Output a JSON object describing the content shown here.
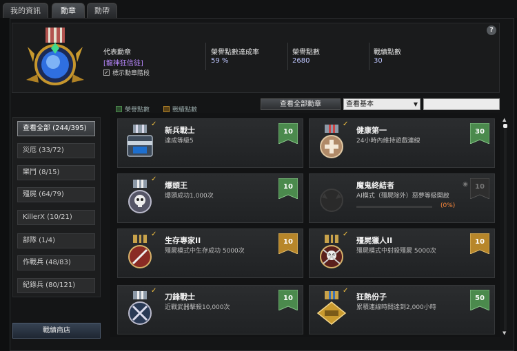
{
  "tabs": [
    {
      "label": "我的資訊",
      "active": false
    },
    {
      "label": "勳章",
      "active": true
    },
    {
      "label": "勳帶",
      "active": false
    }
  ],
  "header": {
    "help_label": "?",
    "rep_medal_label": "代表勳章",
    "rep_medal_name": "[龍神狂信徒]",
    "show_level_label": "標示勳章階段",
    "show_level_checked": "✓",
    "stats": [
      {
        "label": "榮譽點數達成率",
        "value": "59 %"
      },
      {
        "label": "榮譽點數",
        "value": "2680"
      },
      {
        "label": "戰績點數",
        "value": "30"
      }
    ]
  },
  "legend": {
    "honor": "榮譽點數",
    "battle": "戰績點數"
  },
  "filter": {
    "view_all_button": "查看全部勳章",
    "dropdown_value": "查看基本",
    "dropdown_arrow": "▼",
    "search_placeholder": ""
  },
  "categories": [
    {
      "label": "查看全部 (244/395)",
      "active": true
    },
    {
      "label": "災厄 (33/72)",
      "active": false
    },
    {
      "label": "樂鬥 (8/15)",
      "active": false
    },
    {
      "label": "殭屍 (64/79)",
      "active": false
    },
    {
      "label": "KillerX (10/21)",
      "active": false
    },
    {
      "label": "部隊 (1/4)",
      "active": false
    },
    {
      "label": "作戰兵 (48/83)",
      "active": false
    },
    {
      "label": "紀錄兵 (80/121)",
      "active": false
    }
  ],
  "shop_button": "戰績商店",
  "medals": [
    {
      "title": "新兵戰士",
      "desc": "達成等級5",
      "points": "10",
      "type": "honor",
      "achieved": true,
      "icon": "welcome-cso-medal-icon"
    },
    {
      "title": "健康第一",
      "desc": "24小時內維持遊戲連線",
      "points": "30",
      "type": "honor",
      "achieved": true,
      "icon": "health-medal-icon"
    },
    {
      "title": "爆頭王",
      "desc": "爆頭成功1,000次",
      "points": "10",
      "type": "honor",
      "achieved": true,
      "icon": "skull-medal-icon"
    },
    {
      "title": "魔鬼終結者",
      "desc": "AI模式（殭屍除外）惡夢等級開啟",
      "points": "10",
      "type": "locked",
      "achieved": false,
      "icon": "demon-medal-icon",
      "progress_text": "(0%)",
      "progress": 0
    },
    {
      "title": "生存專家II",
      "desc": "殭屍模式中生存成功 5000次",
      "points": "10",
      "type": "battle",
      "achieved": true,
      "icon": "survivor-medal-icon"
    },
    {
      "title": "殭屍獵人II",
      "desc": "殭屍模式中射殺殭屍 5000次",
      "points": "10",
      "type": "battle",
      "achieved": true,
      "icon": "zombie-hunter-medal-icon"
    },
    {
      "title": "刀鋒戰士",
      "desc": "近戰武器擊殺10,000次",
      "points": "10",
      "type": "honor",
      "achieved": true,
      "icon": "blade-medal-icon"
    },
    {
      "title": "狂熱份子",
      "desc": "累積連線時間達到2,000小時",
      "points": "50",
      "type": "honor",
      "achieved": true,
      "icon": "fanatic-medal-icon"
    }
  ],
  "colors": {
    "honor": "#4b8a4d",
    "battle": "#b7862a",
    "locked": "#3a3a3a",
    "accent_purple": "#b988ff",
    "progress_orange": "#ff8a3c"
  }
}
